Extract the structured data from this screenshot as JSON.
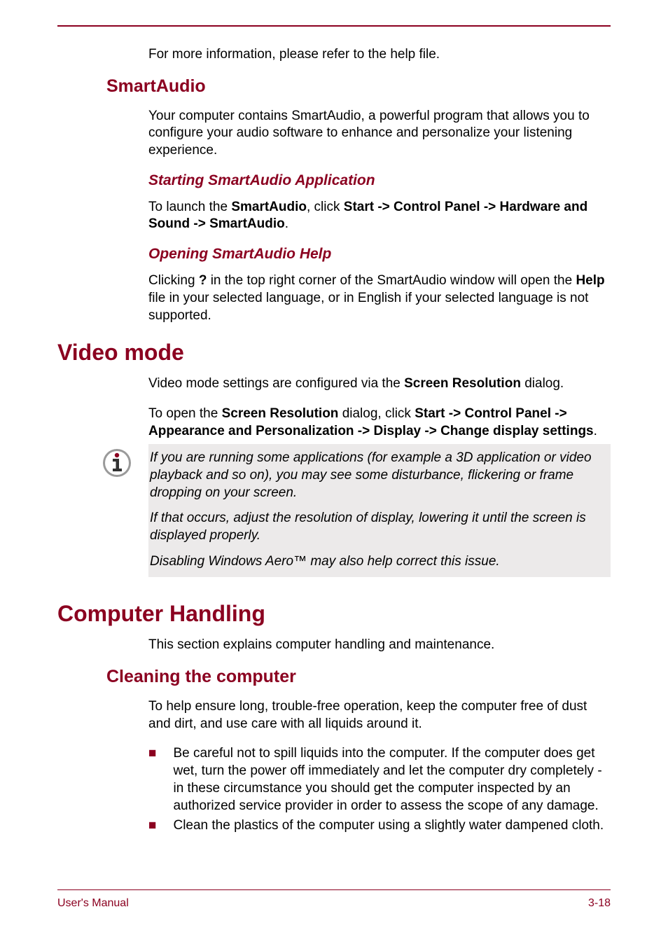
{
  "intro": "For more information, please refer to the help file.",
  "smartaudio": {
    "heading": "SmartAudio",
    "para1": "Your computer contains SmartAudio, a powerful program that allows you to configure your audio software to enhance and personalize your listening experience.",
    "starting": {
      "heading": "Starting SmartAudio Application",
      "pre": "To launch the ",
      "b1": "SmartAudio",
      "mid1": ", click ",
      "b2": "Start -> Control Panel -> Hardware and Sound -> SmartAudio",
      "post": "."
    },
    "opening": {
      "heading": "Opening SmartAudio Help",
      "pre": "Clicking ",
      "b1": "?",
      "mid1": " in the top right corner of the SmartAudio window will open the ",
      "b2": "Help",
      "post": " file in your selected language, or in English if your selected language is not supported."
    }
  },
  "videomode": {
    "heading": "Video mode",
    "para1_pre": "Video mode settings are configured via the ",
    "para1_b": "Screen Resolution",
    "para1_post": " dialog.",
    "para2_pre": "To open the ",
    "para2_b1": "Screen Resolution",
    "para2_mid": " dialog, click ",
    "para2_b2": "Start -> Control Panel -> Appearance and Personalization -> Display -> Change display settings",
    "para2_post": ".",
    "note1": "If you are running some applications (for example a 3D application or video playback and so on), you may see some disturbance, flickering or frame dropping on your screen.",
    "note2": "If that occurs, adjust the resolution of display, lowering it until the screen is displayed properly.",
    "note3": "Disabling Windows Aero™ may also help correct this issue."
  },
  "handling": {
    "heading": "Computer Handling",
    "para1": "This section explains computer handling and maintenance.",
    "cleaning": {
      "heading": "Cleaning the computer",
      "para1": "To help ensure long, trouble-free operation, keep the computer free of dust and dirt, and use care with all liquids around it.",
      "item1": "Be careful not to spill liquids into the computer. If the computer does get wet, turn the power off immediately and let the computer dry completely - in these circumstance you should get the computer inspected by an authorized service provider in order to assess the scope of any damage.",
      "item2": "Clean the plastics of the computer using a slightly water dampened cloth."
    }
  },
  "footer": {
    "left": "User's Manual",
    "right": "3-18"
  }
}
